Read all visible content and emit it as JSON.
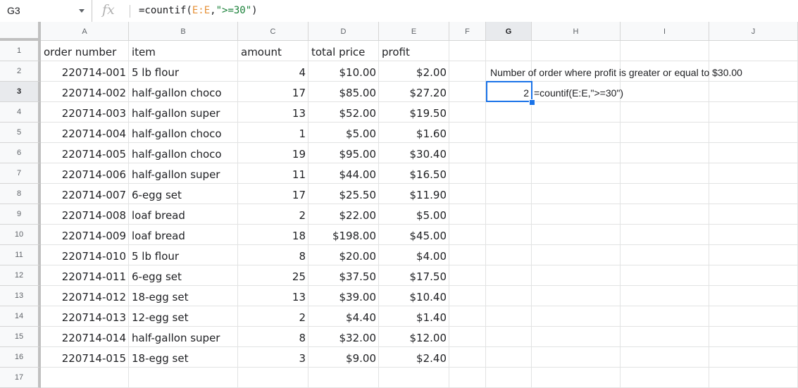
{
  "namebox": "G3",
  "formula_bar": {
    "prefix": "=countif(",
    "ref": "E:E",
    "comma": ",",
    "criteria": "\">=30\"",
    "suffix": ")"
  },
  "columns": [
    "A",
    "B",
    "C",
    "D",
    "E",
    "F",
    "G",
    "H",
    "I",
    "J"
  ],
  "rows": [
    "1",
    "2",
    "3",
    "4",
    "5",
    "6",
    "7",
    "8",
    "9",
    "10",
    "11",
    "12",
    "13",
    "14",
    "15",
    "16",
    "17"
  ],
  "headers": [
    "order number",
    "item",
    "amount",
    "total price",
    "profit"
  ],
  "orders": [
    [
      "220714-001",
      "5 lb flour",
      "4",
      "$10.00",
      "$2.00"
    ],
    [
      "220714-002",
      "half-gallon choco",
      "17",
      "$85.00",
      "$27.20"
    ],
    [
      "220714-003",
      "half-gallon super",
      "13",
      "$52.00",
      "$19.50"
    ],
    [
      "220714-004",
      "half-gallon choco",
      "1",
      "$5.00",
      "$1.60"
    ],
    [
      "220714-005",
      "half-gallon choco",
      "19",
      "$95.00",
      "$30.40"
    ],
    [
      "220714-006",
      "half-gallon super",
      "11",
      "$44.00",
      "$16.50"
    ],
    [
      "220714-007",
      "6-egg set",
      "17",
      "$25.50",
      "$11.90"
    ],
    [
      "220714-008",
      "loaf bread",
      "2",
      "$22.00",
      "$5.00"
    ],
    [
      "220714-009",
      "loaf bread",
      "18",
      "$198.00",
      "$45.00"
    ],
    [
      "220714-010",
      "5 lb flour",
      "8",
      "$20.00",
      "$4.00"
    ],
    [
      "220714-011",
      "6-egg set",
      "25",
      "$37.50",
      "$17.50"
    ],
    [
      "220714-012",
      "18-egg set",
      "13",
      "$39.00",
      "$10.40"
    ],
    [
      "220714-013",
      "12-egg set",
      "2",
      "$4.40",
      "$1.40"
    ],
    [
      "220714-014",
      "half-gallon super",
      "8",
      "$32.00",
      "$12.00"
    ],
    [
      "220714-015",
      "18-egg set",
      "3",
      "$9.00",
      "$2.40"
    ]
  ],
  "note_label": "Number of order where profit is greater or equal to $30.00",
  "result_value": "2",
  "result_formula_text": "=countif(E:E,\">=30\")",
  "colors": {
    "selection": "#1a73e8",
    "reference": "#e69138",
    "string": "#188038"
  }
}
